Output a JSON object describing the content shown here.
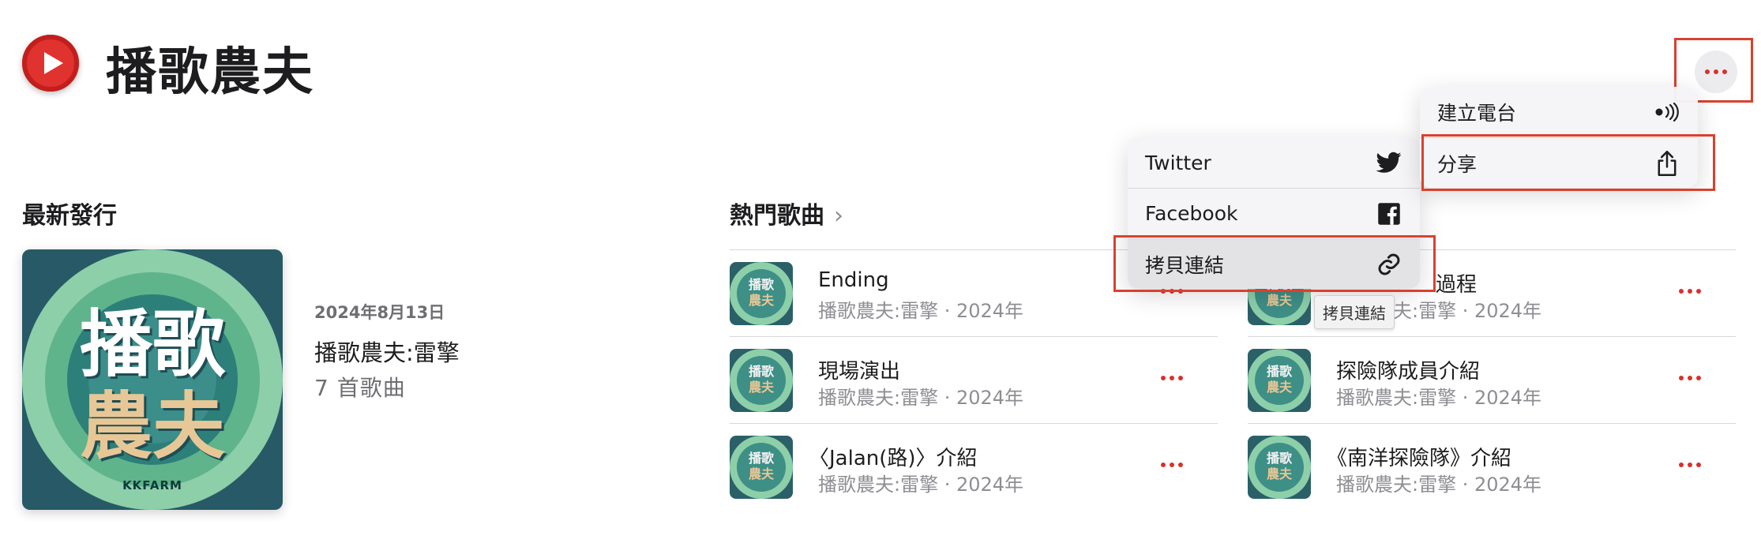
{
  "artist": {
    "name": "播歌農夫",
    "icon": "play-circle-icon",
    "accent_color": "#e0322f"
  },
  "latest_release": {
    "section_title": "最新發行",
    "date": "2024年8月13日",
    "album_name": "播歌農夫:雷擎",
    "track_count": "7 首歌曲",
    "artwork_text_line1": "播歌",
    "artwork_text_line2": "農夫",
    "artwork_brand": "KKFARM"
  },
  "top_songs": {
    "section_title": "熱門歌曲",
    "chevron": "›",
    "thumb_line1": "播歌",
    "thumb_line2": "農夫",
    "songs": [
      {
        "title": "Ending",
        "subtitle": "播歌農夫:雷擎 · 2024年"
      },
      {
        "title": "過程",
        "subtitle": "播歌農夫:雷擎 · 2024年"
      },
      {
        "title": "現場演出",
        "subtitle": "播歌農夫:雷擎 · 2024年"
      },
      {
        "title": "探險隊成員介紹",
        "subtitle": "播歌農夫:雷擎 · 2024年"
      },
      {
        "title": "〈Jalan(路)〉介紹",
        "subtitle": "播歌農夫:雷擎 · 2024年"
      },
      {
        "title": "《南洋探險隊》介紹",
        "subtitle": "播歌農夫:雷擎 · 2024年"
      }
    ]
  },
  "more_menu": {
    "items": [
      {
        "label": "建立電台",
        "icon": "radio-broadcast-icon"
      },
      {
        "label": "分享",
        "icon": "share-icon"
      }
    ]
  },
  "share_menu": {
    "items": [
      {
        "label": "Twitter",
        "icon": "twitter-icon"
      },
      {
        "label": "Facebook",
        "icon": "facebook-icon"
      },
      {
        "label": "拷貝連結",
        "icon": "link-icon"
      }
    ]
  },
  "tooltip": "拷貝連結",
  "highlight_color": "#d9412e"
}
